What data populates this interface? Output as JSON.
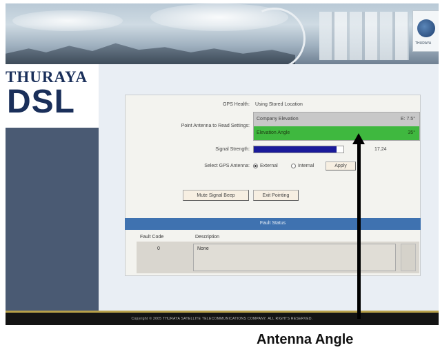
{
  "banner": {
    "logo_text": "THURAYA"
  },
  "brand": {
    "line1": "THURAYA",
    "line2": "DSL"
  },
  "gps": {
    "label": "GPS Health:",
    "value": "Using Stored Location"
  },
  "antenna": {
    "label": "Point Antenna to Read Settings:",
    "options": [
      {
        "label": "Company Elevation",
        "value": "E: 7.5°"
      },
      {
        "label": "Elevation Angle",
        "value": "35°"
      }
    ],
    "selected_index": 1
  },
  "signal": {
    "label": "Signal Strength:",
    "value_text": "17.24",
    "level": 0.92
  },
  "gps_antenna": {
    "label": "Select GPS Antenna:",
    "opt1": "External",
    "opt2": "Internal",
    "selected": "External",
    "apply_label": "Apply"
  },
  "actions": {
    "beep_label": "Mute Signal Beep",
    "exit_label": "Exit Pointing"
  },
  "fault": {
    "title": "Fault Status",
    "col_code": "Fault Code",
    "col_desc": "Description",
    "rows": [
      {
        "code": "0",
        "desc": "None"
      }
    ]
  },
  "footer": {
    "copyright": "Copyright © 2005 THURAYA SATELLITE TELECOMMUNICATIONS COMPANY. ALL RIGHTS RESERVED."
  },
  "annotation": {
    "caption": "Antenna Angle"
  }
}
